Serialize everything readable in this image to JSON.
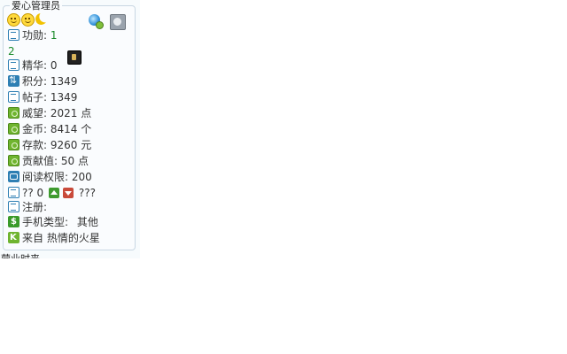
{
  "profile": {
    "group_title": "爱心管理员",
    "mood_icons": [
      "smile-icon",
      "smile-icon",
      "moon-icon"
    ],
    "top_icons": [
      "globe-user-icon",
      "avatar-icon"
    ],
    "stats": {
      "merit_label": "功勋:",
      "merit_value": "1",
      "merit_extra": "2",
      "essence": "精华: 0",
      "points": "积分: 1349",
      "posts": "帖子: 1349",
      "prestige": "威望: 2021 点",
      "gold": "金币: 8414 个",
      "deposit": "存款: 9260 元",
      "contribution": "贡献值: 50 点",
      "read_permission": "阅读权限: 200",
      "rating_prefix": "?? 0",
      "rating_suffix": "???",
      "registered": "注册:",
      "phone_type_label": "手机类型:",
      "phone_type_value": "其他",
      "location": "来自 热情的火星"
    }
  },
  "footer": {
    "cut_text": "营业时来"
  }
}
